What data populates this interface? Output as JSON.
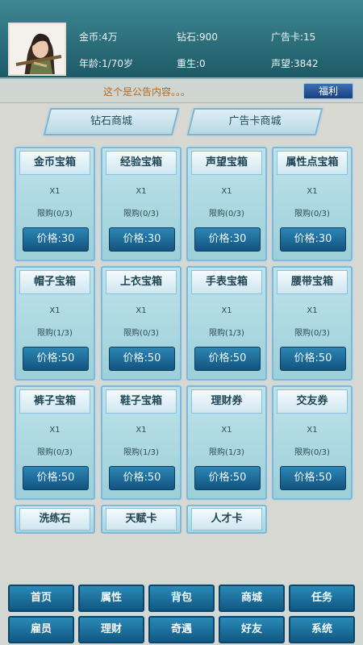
{
  "player": {
    "gold": "金币:4万",
    "diamond": "钻石:900",
    "ad_card": "广告卡:15",
    "age": "年龄:1/70岁",
    "rebirth": "重生:0",
    "prestige": "声望:3842"
  },
  "notice": {
    "text": "这个是公告内容。。。",
    "welfare_label": "福利"
  },
  "mall_tabs": [
    "钻石商城",
    "广告卡商城"
  ],
  "shop_items": [
    {
      "title": "金币宝箱",
      "qty": "X1",
      "limit": "限购(0/3)",
      "price": "价格:30"
    },
    {
      "title": "经验宝箱",
      "qty": "X1",
      "limit": "限购(0/3)",
      "price": "价格:30"
    },
    {
      "title": "声望宝箱",
      "qty": "X1",
      "limit": "限购(0/3)",
      "price": "价格:30"
    },
    {
      "title": "属性点宝箱",
      "qty": "X1",
      "limit": "限购(0/3)",
      "price": "价格:30"
    },
    {
      "title": "帽子宝箱",
      "qty": "X1",
      "limit": "限购(1/3)",
      "price": "价格:50"
    },
    {
      "title": "上衣宝箱",
      "qty": "X1",
      "limit": "限购(0/3)",
      "price": "价格:50"
    },
    {
      "title": "手表宝箱",
      "qty": "X1",
      "limit": "限购(1/3)",
      "price": "价格:50"
    },
    {
      "title": "腰带宝箱",
      "qty": "X1",
      "limit": "限购(0/3)",
      "price": "价格:50"
    },
    {
      "title": "裤子宝箱",
      "qty": "X1",
      "limit": "限购(0/3)",
      "price": "价格:50"
    },
    {
      "title": "鞋子宝箱",
      "qty": "X1",
      "limit": "限购(1/3)",
      "price": "价格:50"
    },
    {
      "title": "理财券",
      "qty": "X1",
      "limit": "限购(1/3)",
      "price": "价格:50"
    },
    {
      "title": "交友券",
      "qty": "X1",
      "limit": "限购(0/3)",
      "price": "价格:50"
    }
  ],
  "partial_items": [
    "洗练石",
    "天赋卡",
    "人才卡"
  ],
  "nav": {
    "row1": [
      "首页",
      "属性",
      "背包",
      "商城",
      "任务"
    ],
    "row2": [
      "雇员",
      "理财",
      "奇遇",
      "好友",
      "系统"
    ]
  }
}
